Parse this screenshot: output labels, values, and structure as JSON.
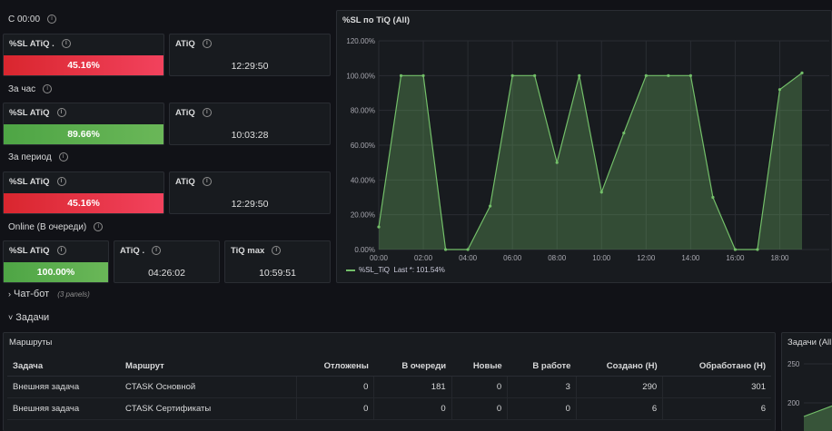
{
  "left": {
    "groups": [
      {
        "label": "С 00:00",
        "sl_title": "%SL ATiQ .",
        "sl_value": "45.16%",
        "sl_color": "red",
        "atiq_title": "ATiQ",
        "atiq_value": "12:29:50"
      },
      {
        "label": "За час",
        "sl_title": "%SL ATiQ",
        "sl_value": "89.66%",
        "sl_color": "green",
        "atiq_title": "ATiQ",
        "atiq_value": "10:03:28"
      },
      {
        "label": "За период",
        "sl_title": "%SL ATiQ",
        "sl_value": "45.16%",
        "sl_color": "red",
        "atiq_title": "ATiQ",
        "atiq_value": "12:29:50"
      }
    ],
    "online": {
      "label": "Online (В очереди)",
      "sl_title": "%SL ATiQ",
      "sl_value": "100.00%",
      "atiq_title": "ATiQ .",
      "atiq_value": "04:26:02",
      "tiqmax_title": "TiQ max",
      "tiqmax_value": "10:59:51"
    }
  },
  "chart": {
    "panel_title": "%SL по TiQ (All)",
    "legend": "%SL_TiQ",
    "legend_last": "Last *: 101.54%",
    "color": "#73bf69"
  },
  "chart_data": {
    "type": "area",
    "title": "%SL по TiQ (All)",
    "y_ticks": [
      "0.00%",
      "20.00%",
      "40.00%",
      "60.00%",
      "80.00%",
      "100.00%",
      "120.00%"
    ],
    "x_ticks": [
      "00:00",
      "02:00",
      "04:00",
      "06:00",
      "08:00",
      "10:00",
      "12:00",
      "14:00",
      "16:00",
      "18:00"
    ],
    "ylim": [
      0,
      120
    ],
    "xlim": [
      0,
      19
    ],
    "x": [
      0,
      1,
      2,
      3,
      4,
      5,
      6,
      7,
      8,
      9,
      10,
      11,
      12,
      13,
      14,
      15,
      16,
      17,
      18,
      19
    ],
    "series": [
      {
        "name": "%SL_TiQ",
        "values": [
          13,
          100,
          100,
          0,
          0,
          25,
          100,
          100,
          50,
          100,
          33,
          67,
          100,
          100,
          100,
          30,
          0,
          0,
          92,
          101.54
        ]
      }
    ],
    "grid": true,
    "legend_position": "bottom-left"
  },
  "rows": {
    "chatbot": "Чат-бот",
    "chatbot_count": "(3 panels)",
    "tasks": "Задачи"
  },
  "routes": {
    "panel_title": "Маршруты",
    "headers": [
      "Задача",
      "Маршрут",
      "Отложены",
      "В очереди",
      "Новые",
      "В работе",
      "Создано (Н)",
      "Обработано (Н)"
    ],
    "rows": [
      [
        "Внешняя задача",
        "CTASK Основной",
        "0",
        "181",
        "0",
        "3",
        "290",
        "301"
      ],
      [
        "Внешняя задача",
        "CTASK Сертификаты",
        "0",
        "0",
        "0",
        "0",
        "6",
        "6"
      ]
    ]
  },
  "right_panel": {
    "title": "Задачи (All",
    "y_ticks": [
      "250",
      "200"
    ]
  }
}
